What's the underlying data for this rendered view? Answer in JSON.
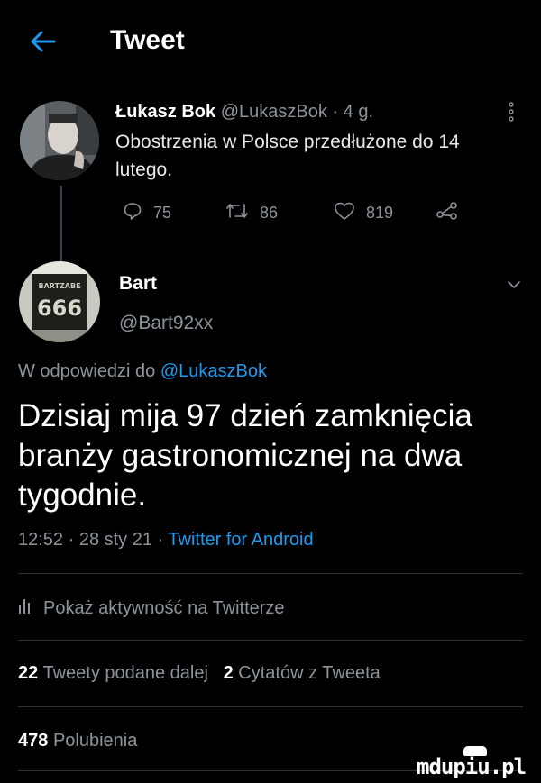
{
  "header": {
    "title": "Tweet"
  },
  "reply_tweet": {
    "author_name": "Łukasz Bok",
    "author_handle": "@LukaszBok",
    "time": "· 4 g.",
    "text": "Obostrzenia w Polsce przedłużone do 14 lutego.",
    "replies": "75",
    "retweets": "86",
    "likes": "819"
  },
  "main_tweet": {
    "author_name": "Bart",
    "author_handle": "@Bart92xx",
    "avatar_text": "BARTZABE 666",
    "replying_prefix": "W odpowiedzi do",
    "replying_to": "@LukaszBok",
    "text": "Dzisiaj mija 97 dzień zamknięcia branży gastronomicznej na dwa tygodnie.",
    "timestamp": "12:52 · 28 sty 21 ·",
    "source": "Twitter for Android"
  },
  "activity_label": "Pokaż aktywność na Twitterze",
  "stats": {
    "retweets_count": "22",
    "retweets_label": "Tweety podane dalej",
    "quotes_count": "2",
    "quotes_label": "Cytatów z Tweeta",
    "likes_count": "478",
    "likes_label": "Polubienia"
  },
  "watermark": "mdupiu.pl",
  "colors": {
    "background": "#000000",
    "accent": "#1d9bf0",
    "muted": "#8b949a",
    "divider": "#2f3336"
  },
  "icons": [
    "back-arrow-icon",
    "more-vertical-icon",
    "reply-icon",
    "retweet-icon",
    "like-icon",
    "share-icon",
    "chevron-down-icon",
    "activity-chart-icon"
  ]
}
